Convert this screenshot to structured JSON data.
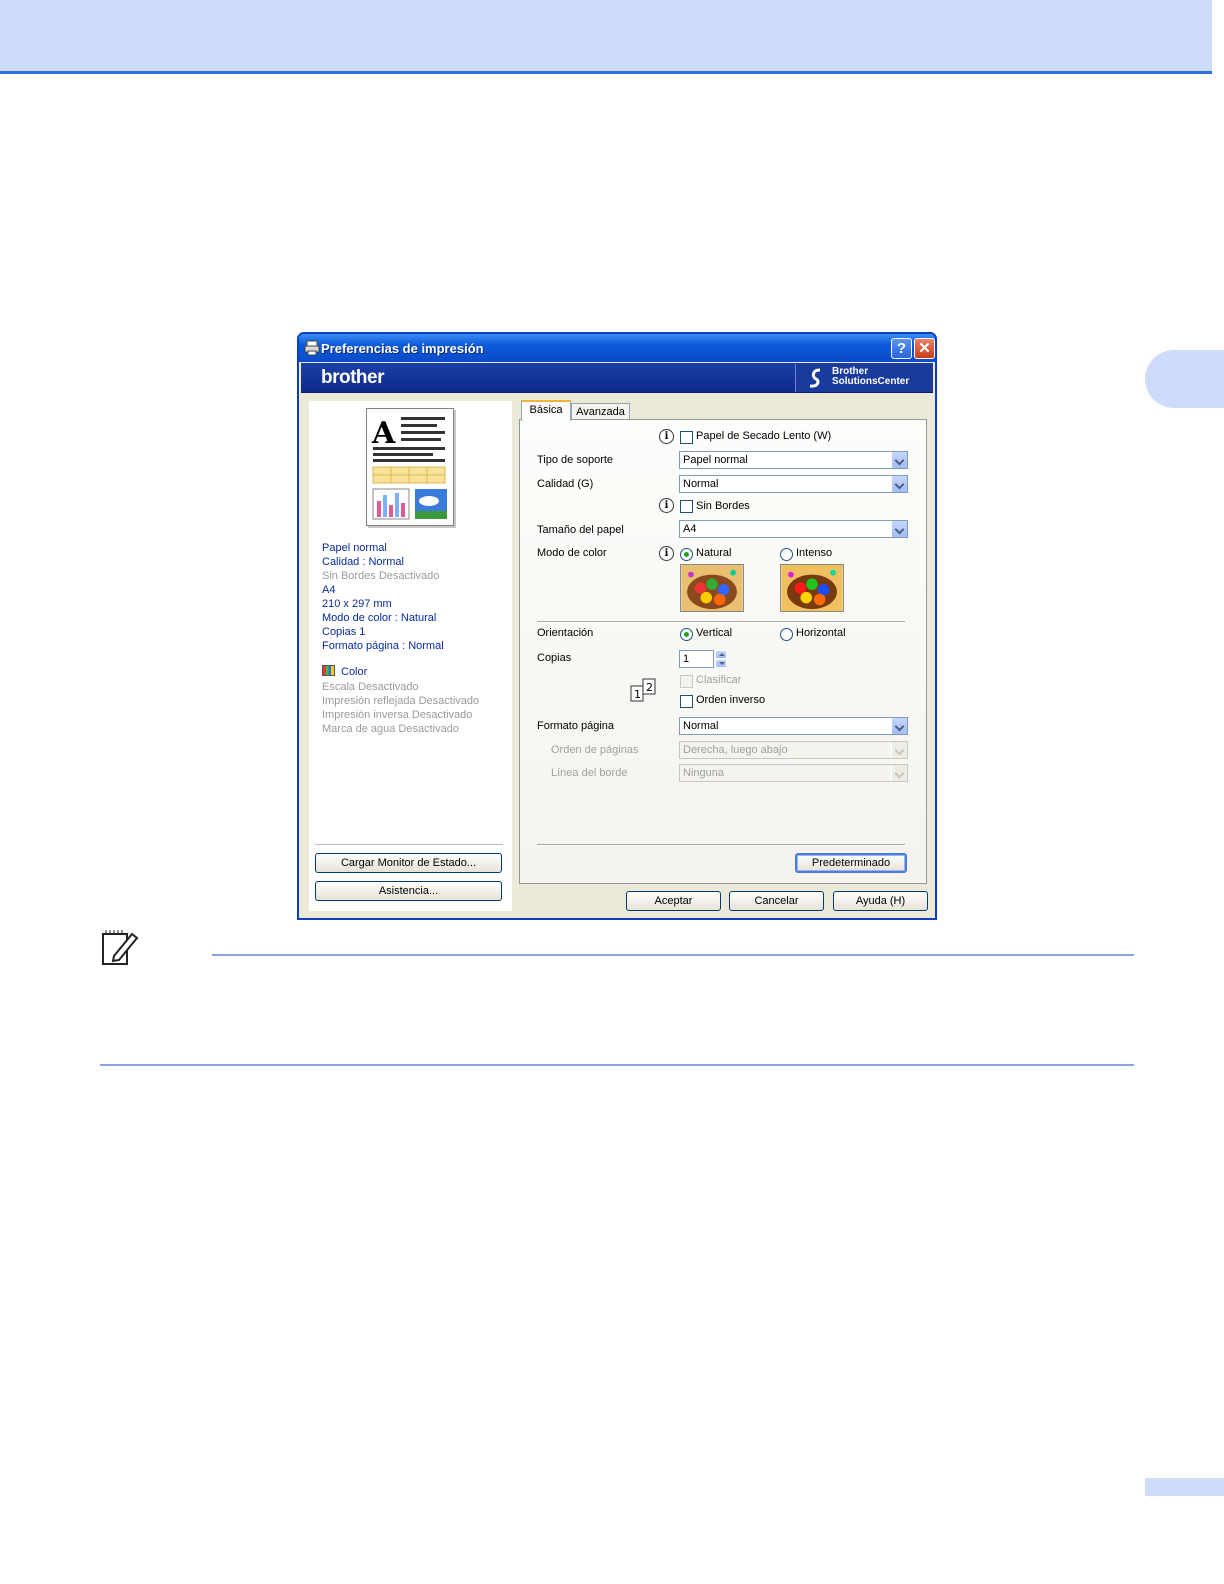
{
  "dialog": {
    "title": "Preferencias de impresión",
    "help_button": "?",
    "close_button": "✕",
    "brand": "brother",
    "solutions_line1": "Brother",
    "solutions_line2": "SolutionsCenter"
  },
  "summary": {
    "lines": [
      {
        "text": "Papel normal",
        "enabled": true
      },
      {
        "text": "Calidad  : Normal",
        "enabled": true
      },
      {
        "text": "Sin Bordes Desactivado",
        "enabled": false
      },
      {
        "text": "A4",
        "enabled": true
      },
      {
        "text": "210 x 297 mm",
        "enabled": true
      },
      {
        "text": "Modo de color : Natural",
        "enabled": true
      },
      {
        "text": "Copias 1",
        "enabled": true
      },
      {
        "text": "Formato página : Normal",
        "enabled": true
      }
    ],
    "color_label": "Color",
    "extra_lines": [
      "Escala Desactivado",
      "Impresión reflejada Desactivado",
      "Impresión inversa Desactivado",
      "Marca de agua Desactivado"
    ]
  },
  "left_buttons": {
    "status_monitor": "Cargar Monitor de Estado...",
    "support": "Asistencia..."
  },
  "tabs": [
    {
      "label": "Básica",
      "active": true
    },
    {
      "label": "Avanzada",
      "active": false
    }
  ],
  "basic": {
    "slow_dry": "Papel de Secado Lento (W)",
    "media_type_label": "Tipo de soporte",
    "media_type_value": "Papel normal",
    "quality_label": "Calidad (G)",
    "quality_value": "Normal",
    "borderless": "Sin Bordes",
    "paper_size_label": "Tamaño del papel",
    "paper_size_value": "A4",
    "color_mode_label": "Modo de color",
    "color_natural": "Natural",
    "color_vivid": "Intenso",
    "orientation_label": "Orientación",
    "orientation_portrait": "Vertical",
    "orientation_landscape": "Horizontal",
    "copies_label": "Copias",
    "copies_value": "1",
    "collate": "Clasificar",
    "reverse_order": "Orden inverso",
    "page_format_label": "Formato página",
    "page_format_value": "Normal",
    "page_order_label": "Orden de páginas",
    "page_order_value": "Derecha, luego abajo",
    "border_line_label": "Línea del borde",
    "border_line_value": "Ninguna",
    "default_button": "Predeterminado"
  },
  "footer_buttons": {
    "ok": "Aceptar",
    "cancel": "Cancelar",
    "help": "Ayuda (H)"
  },
  "colors": {
    "title_bar": "#0a5ad8",
    "header_band": "#cddcfb",
    "accent_rule": "#2f6fe3",
    "summary_text": "#0a2a9e"
  }
}
